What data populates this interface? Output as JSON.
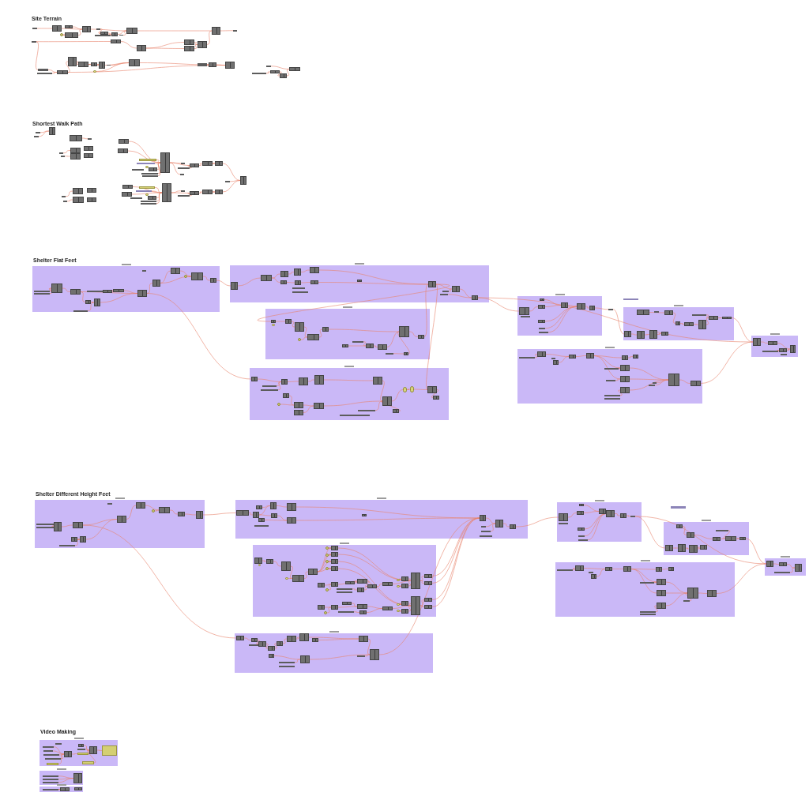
{
  "canvas": {
    "sections": [
      {
        "title": "Site Terrain"
      },
      {
        "title": "Shortest Walk Path"
      },
      {
        "title": "Shelter Flat Feet"
      },
      {
        "title": "Shelter Different Height Feet"
      },
      {
        "title": "Video Making"
      }
    ]
  }
}
